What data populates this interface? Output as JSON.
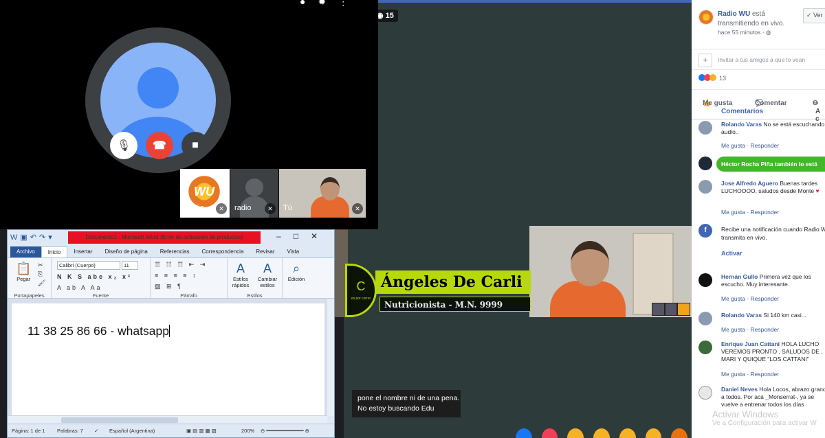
{
  "colors": {
    "fb_blue": "#4267b2",
    "meet_hangup": "#ea4335",
    "word_blue": "#2b579a",
    "lowerthird_green": "#b7d90a"
  },
  "live": {
    "viewer_count": "15",
    "subtitle_line1": "pone el nombre ni de una pena.",
    "subtitle_line2": "No estoy buscando Edu"
  },
  "lower_third": {
    "name": "Ángeles De Carli",
    "title": "Nutricionista - M.N. 9999",
    "emblem_caption": "es por correr"
  },
  "studio_logo": "WU",
  "meet": {
    "top_icons": [
      "person-icon",
      "settings-icon",
      "more-icon"
    ],
    "tiles": [
      {
        "label": "Radio",
        "logo_text": "WU"
      },
      {
        "label": "radio"
      },
      {
        "label": "Tú"
      }
    ]
  },
  "word": {
    "window_title": "Documento1  -  Microsoft Word (Error de activación de productos)",
    "tabs": [
      "Archivo",
      "Inicio",
      "Insertar",
      "Diseño de página",
      "Referencias",
      "Correspondencia",
      "Revisar",
      "Vista"
    ],
    "active_tab": "Inicio",
    "paste_label": "Pegar",
    "font_name": "Calibri (Cuerpo)",
    "font_size": "11",
    "group_names": [
      "Portapapeles",
      "Fuente",
      "Párrafo",
      "Estilos"
    ],
    "styles_quick": "Estilos rápidos",
    "styles_change": "Cambiar estilos",
    "editing": "Edición",
    "document_text": "11 38 25 86 66 - whatsapp",
    "status": {
      "page": "Página: 1 de 1",
      "words": "Palabras: 7",
      "language": "Español (Argentina)",
      "zoom": "200%"
    }
  },
  "facebook": {
    "page_name": "Radio WU",
    "live_text": "está transmitiendo en vivo.",
    "time": "hace 55 minutos · ",
    "follow_label": "Ver",
    "invite_placeholder": "Invitar a tus amigos a que lo vean",
    "reaction_count": "13",
    "actions": {
      "like": "Me gusta",
      "comment": "Comentar",
      "share": "C"
    },
    "tabs": {
      "comments": "Comentarios",
      "other": "A c"
    },
    "share_bar": "Héctor Rocha Piña también lo está",
    "notify": {
      "text": "Recibe una notificación cuando Radio WU transmita en vivo.",
      "button": "Activar"
    },
    "links": {
      "like": "Me gusta",
      "reply": "Responder"
    },
    "comments": [
      {
        "author": "Rolando Varas",
        "text": "No se está escuchando el audio.."
      },
      {
        "author": "Jose Alfredo Aguero",
        "text": "Buenas tardes LUCHOOOO, saludos desde Monte"
      },
      {
        "author": "Hernán Gullo",
        "text": "Primera vez que los escucho. Muy interesante."
      },
      {
        "author": "Rolando Varas",
        "text": "Si 140 km casi..."
      },
      {
        "author": "Enrique Juan Cattani",
        "text": "HOLA LUCHO VEREMOS PRONTO , SALUDOS DE , MARI Y QUIQUE \"LOS CATTANI\""
      },
      {
        "author": "Daniel Neves",
        "text": "Hola Locos, abrazo grande a todos. Por acá _Monserrat-, ya se vuelve a entrenar todos los días"
      }
    ]
  },
  "watermark": {
    "line1": "Activar Windows",
    "line2": "Ve a Configuración para activar W"
  }
}
